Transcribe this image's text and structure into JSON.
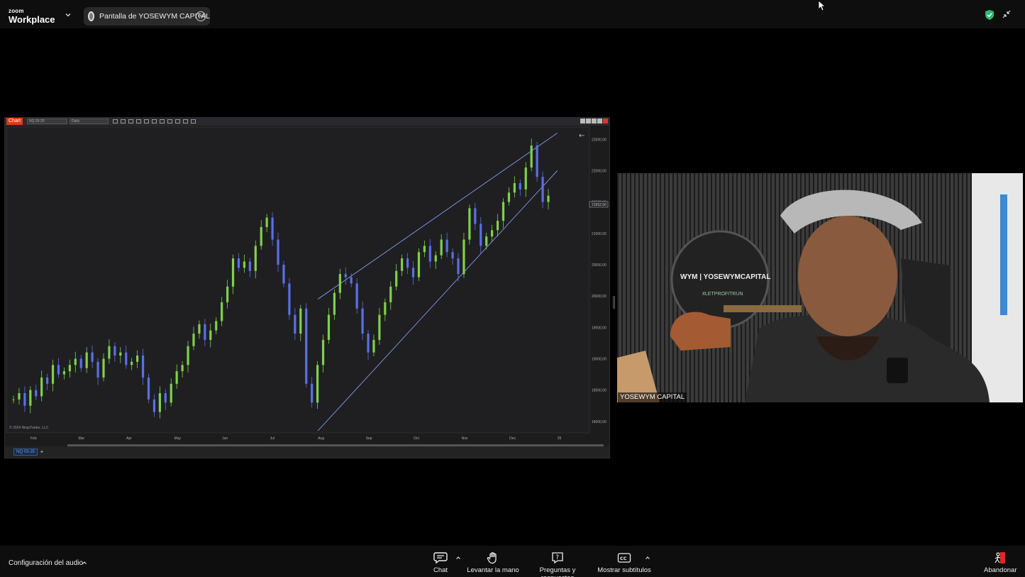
{
  "app": {
    "brand_small": "zoom",
    "brand_big": "Workplace"
  },
  "share": {
    "label": "Pantalla de YOSEWYM CAPITAL",
    "more_icon": "ellipsis-icon"
  },
  "chart_window": {
    "tag": "Chart",
    "instrument": "NQ 03-25",
    "interval": "Daily",
    "copyright": "© 2024 NinjaTrader, LLC",
    "tab_label": "NQ 03-25",
    "tab_add": "+",
    "back_arrow": "←",
    "last_price": "21552,50"
  },
  "chart_data": {
    "type": "candlestick",
    "x_labels": [
      "Feb",
      "Mar",
      "Apr",
      "May",
      "Jun",
      "Jul",
      "Aug",
      "Sep",
      "Oct",
      "Nov",
      "Dec",
      "25"
    ],
    "y_ticks": [
      "22500,00",
      "22000,00",
      "21500,00",
      "21000,00",
      "20500,00",
      "20000,00",
      "19500,00",
      "19000,00",
      "18500,00",
      "18000,00"
    ],
    "ylim": [
      17850,
      22650
    ],
    "close_path": [
      18350,
      18450,
      18250,
      18500,
      18400,
      18700,
      18600,
      18900,
      18750,
      18800,
      18900,
      19000,
      18850,
      19100,
      18950,
      18700,
      19000,
      19200,
      19050,
      19100,
      18900,
      18950,
      19050,
      18700,
      18350,
      18150,
      18450,
      18300,
      18600,
      18800,
      18900,
      19200,
      19400,
      19550,
      19300,
      19450,
      19600,
      19900,
      20150,
      20600,
      20450,
      20550,
      20400,
      20800,
      21100,
      21250,
      20900,
      20500,
      20200,
      19700,
      19400,
      19800,
      18600,
      18300,
      18900,
      19300,
      19700,
      20050,
      20350,
      20300,
      20200,
      19800,
      19400,
      19100,
      19300,
      19700,
      19900,
      20150,
      20400,
      20600,
      20450,
      20300,
      20700,
      20800,
      20550,
      20650,
      20900,
      20700,
      20600,
      20350,
      20900,
      21400,
      21150,
      20800,
      20950,
      21050,
      21200,
      21500,
      21650,
      21800,
      21700,
      22050,
      22400,
      21900,
      21500,
      21600
    ],
    "channel_lines": [
      {
        "name": "upper",
        "from": [
          "Aug",
          19950
        ],
        "to": [
          "25",
          22600
        ]
      },
      {
        "name": "lower",
        "from": [
          "Aug",
          17850
        ],
        "to": [
          "25",
          22000
        ]
      }
    ],
    "colors": {
      "up": "#7fd14a",
      "down": "#5b6fe6",
      "channel": "#8fa8ff"
    }
  },
  "video": {
    "participant_name": "YOSEWYM CAPITAL",
    "wall_logo_text": "WYM | YOSEWYMCAPITAL",
    "wall_tagline": "#LETPROFITRUN"
  },
  "bottom": {
    "audio_config": "Configuración del audio",
    "chat": "Chat",
    "raise_hand": "Levantar la mano",
    "qa": "Preguntas y respuestas",
    "captions": "Mostrar subtítulos",
    "leave": "Abandonar"
  },
  "colors": {
    "leave_red": "#e02828",
    "shield_green": "#2eb872",
    "chart_tag_red": "#d9391c"
  }
}
